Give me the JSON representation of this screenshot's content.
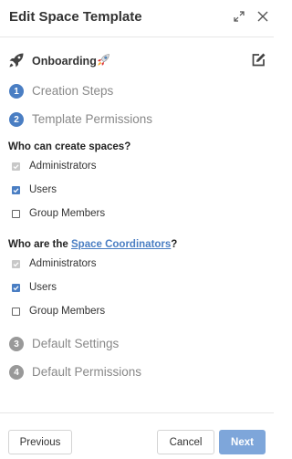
{
  "dialog": {
    "title": "Edit Space Template"
  },
  "template": {
    "name": "Onboarding",
    "icon": "rocket-icon",
    "emoji": "rocket-emoji"
  },
  "steps": [
    {
      "number": "1",
      "label": "Creation Steps",
      "active": true
    },
    {
      "number": "2",
      "label": "Template Permissions",
      "active": true
    },
    {
      "number": "3",
      "label": "Default Settings",
      "active": false
    },
    {
      "number": "4",
      "label": "Default Permissions",
      "active": false
    }
  ],
  "create_spaces": {
    "question": "Who can create spaces?",
    "options": [
      {
        "label": "Administrators",
        "state": "checked-disabled"
      },
      {
        "label": "Users",
        "state": "checked"
      },
      {
        "label": "Group Members",
        "state": "unchecked"
      }
    ]
  },
  "coordinators": {
    "question_prefix": "Who are the ",
    "question_link": "Space Coordinators",
    "question_suffix": "?",
    "options": [
      {
        "label": "Administrators",
        "state": "checked-disabled"
      },
      {
        "label": "Users",
        "state": "checked"
      },
      {
        "label": "Group Members",
        "state": "unchecked"
      }
    ]
  },
  "footer": {
    "previous_label": "Previous",
    "cancel_label": "Cancel",
    "next_label": "Next"
  },
  "colors": {
    "accent": "#4a7ec3",
    "next_button": "#7ea6da",
    "inactive_step": "#999999"
  }
}
